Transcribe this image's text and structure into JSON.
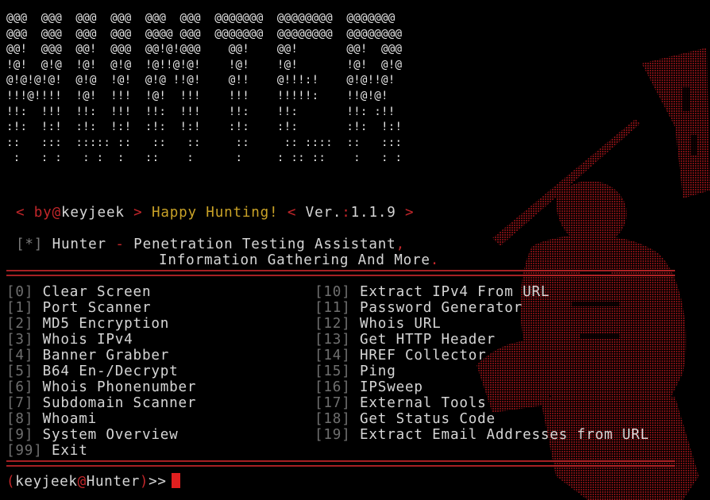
{
  "banner": {
    "art": "@@@  @@@  @@@  @@@  @@@  @@@  @@@@@@@  @@@@@@@@  @@@@@@@\n@@@  @@@  @@@  @@@  @@@@ @@@  @@@@@@@  @@@@@@@@  @@@@@@@@\n@@!  @@@  @@!  @@@  @@!@!@@@    @@!    @@!       @@!  @@@\n!@!  @!@  !@!  @!@  !@!!@!@!    !@!    !@!       !@!  @!@\n@!@!@!@!  @!@  !@!  @!@ !!@!    @!!    @!!!:!    @!@!!@!\n!!!@!!!!  !@!  !!!  !@!  !!!    !!!    !!!!!:    !!@!@!\n!!:  !!!  !!:  !!!  !!:  !!!    !!:    !!:       !!: :!!\n:!:  !:!  :!:  !:!  :!:  !:!    :!:    :!:       :!:  !:!\n::   :::  ::::: ::   ::   ::     ::     :: ::::  ::   :::\n :   : :   : :  :   ::    :      :     : :: ::    :   : :"
  },
  "tagline": {
    "by_prefix": "< by",
    "at": "@",
    "author": "keyjeek",
    "sep1": ">",
    "happy": "Happy Hunting!",
    "sep2": "<",
    "ver_label": "Ver.",
    "ver_colon": ":",
    "ver_value": "1.1.9",
    "sep3": ">"
  },
  "title": {
    "marker": "[*]",
    "line1": "Hunter",
    "dash": "-",
    "line1_rest": "Penetration Testing Assistant",
    "comma": ",",
    "line2": "Information Gathering And More",
    "period": "."
  },
  "menu": {
    "left": [
      {
        "num": "0",
        "label": "Clear Screen"
      },
      {
        "num": "1",
        "label": "Port Scanner"
      },
      {
        "num": "2",
        "label": "MD5 Encryption"
      },
      {
        "num": "3",
        "label": "Whois IPv4"
      },
      {
        "num": "4",
        "label": "Banner Grabber"
      },
      {
        "num": "5",
        "label": "B64 En-/Decrypt"
      },
      {
        "num": "6",
        "label": "Whois Phonenumber"
      },
      {
        "num": "7",
        "label": "Subdomain Scanner"
      },
      {
        "num": "8",
        "label": "Whoami"
      },
      {
        "num": "9",
        "label": "System Overview"
      },
      {
        "num": "99",
        "label": "Exit"
      }
    ],
    "right": [
      {
        "num": "10",
        "label": "Extract IPv4 From URL"
      },
      {
        "num": "11",
        "label": "Password Generator"
      },
      {
        "num": "12",
        "label": "Whois URL"
      },
      {
        "num": "13",
        "label": "Get HTTP Header"
      },
      {
        "num": "14",
        "label": "HREF Collector"
      },
      {
        "num": "15",
        "label": "Ping"
      },
      {
        "num": "16",
        "label": "IPSweep"
      },
      {
        "num": "17",
        "label": "External Tools"
      },
      {
        "num": "18",
        "label": "Get Status Code"
      },
      {
        "num": "19",
        "label": "Extract Email Addresses from URL"
      }
    ]
  },
  "prompt": {
    "open": "(",
    "user": "keyjeek",
    "at": "@",
    "host": "Hunter",
    "close": ")",
    "arrows": ">>"
  },
  "colors": {
    "accent_red": "#c2262a",
    "text": "#d6d6d6",
    "dim": "#6f6f6f",
    "yellow": "#c9a227",
    "background": "#000000",
    "cursor": "#e01f1f"
  }
}
